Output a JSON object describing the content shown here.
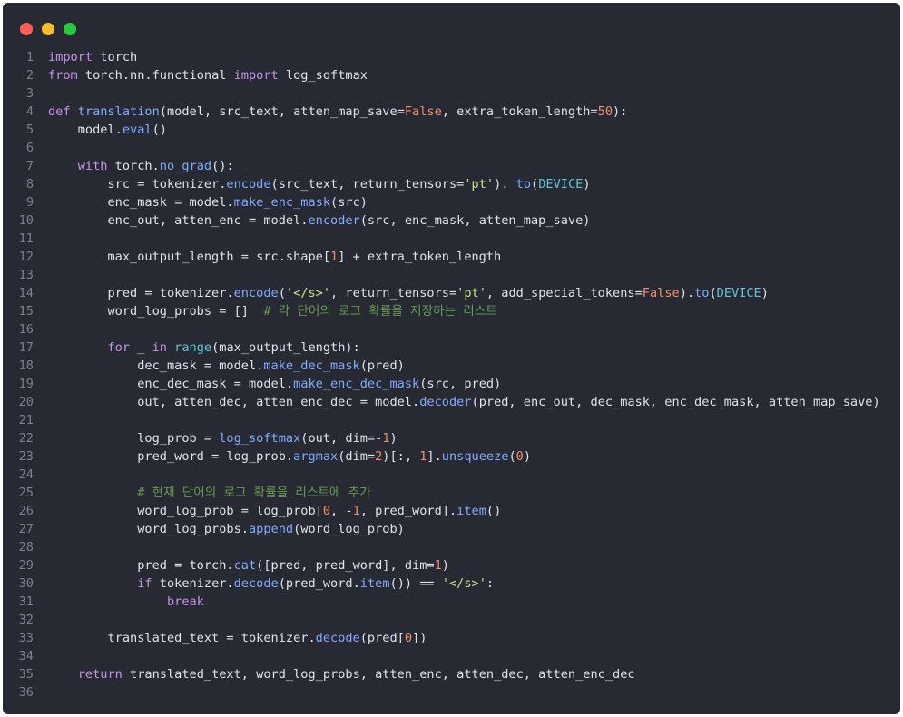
{
  "window": {
    "buttons": [
      {
        "name": "close",
        "color": "#ff5f57"
      },
      {
        "name": "minimize",
        "color": "#febc2e"
      },
      {
        "name": "maximize",
        "color": "#28c840"
      }
    ]
  },
  "theme": {
    "background": "#282a33",
    "keyword": "#c792ea",
    "function": "#82aaff",
    "number": "#f78c6c",
    "string": "#c3e88d",
    "comment": "#6a9955",
    "builtin": "#5fc4d4",
    "text": "#dfe3ea",
    "line_number": "#7a8093"
  },
  "lines": [
    [
      [
        "kw",
        "import"
      ],
      [
        "id",
        " torch"
      ]
    ],
    [
      [
        "kw",
        "from"
      ],
      [
        "id",
        " torch.nn.functional "
      ],
      [
        "kw",
        "import"
      ],
      [
        "id",
        " log_softmax"
      ]
    ],
    [],
    [
      [
        "kw",
        "def"
      ],
      [
        "id",
        " "
      ],
      [
        "fn",
        "translation"
      ],
      [
        "id",
        "(model, src_text, atten_map_save="
      ],
      [
        "num",
        "False"
      ],
      [
        "id",
        ", extra_token_length="
      ],
      [
        "num",
        "50"
      ],
      [
        "id",
        "):"
      ]
    ],
    [
      [
        "id",
        "    model."
      ],
      [
        "fn",
        "eval"
      ],
      [
        "id",
        "()"
      ]
    ],
    [],
    [
      [
        "id",
        "    "
      ],
      [
        "kw",
        "with"
      ],
      [
        "id",
        " torch."
      ],
      [
        "fn",
        "no_grad"
      ],
      [
        "id",
        "():"
      ]
    ],
    [
      [
        "id",
        "        src = tokenizer."
      ],
      [
        "fn",
        "encode"
      ],
      [
        "id",
        "(src_text, return_tensors="
      ],
      [
        "str",
        "'pt'"
      ],
      [
        "id",
        "). "
      ],
      [
        "fn",
        "to"
      ],
      [
        "id",
        "("
      ],
      [
        "bi",
        "DEVICE"
      ],
      [
        "id",
        ")"
      ]
    ],
    [
      [
        "id",
        "        enc_mask = model."
      ],
      [
        "fn",
        "make_enc_mask"
      ],
      [
        "id",
        "(src)"
      ]
    ],
    [
      [
        "id",
        "        enc_out, atten_enc = model."
      ],
      [
        "fn",
        "encoder"
      ],
      [
        "id",
        "(src, enc_mask, atten_map_save)"
      ]
    ],
    [],
    [
      [
        "id",
        "        max_output_length = src.shape["
      ],
      [
        "num",
        "1"
      ],
      [
        "id",
        "] + extra_token_length"
      ]
    ],
    [],
    [
      [
        "id",
        "        pred = tokenizer."
      ],
      [
        "fn",
        "encode"
      ],
      [
        "id",
        "("
      ],
      [
        "str",
        "'</s>'"
      ],
      [
        "id",
        ", return_tensors="
      ],
      [
        "str",
        "'pt'"
      ],
      [
        "id",
        ", add_special_tokens="
      ],
      [
        "num",
        "False"
      ],
      [
        "id",
        ")."
      ],
      [
        "fn",
        "to"
      ],
      [
        "id",
        "("
      ],
      [
        "bi",
        "DEVICE"
      ],
      [
        "id",
        ")"
      ]
    ],
    [
      [
        "id",
        "        word_log_probs = []  "
      ],
      [
        "com",
        "# 각 단어의 로그 확률을 저장하는 리스트"
      ]
    ],
    [],
    [
      [
        "id",
        "        "
      ],
      [
        "kw",
        "for"
      ],
      [
        "id",
        " _ "
      ],
      [
        "kw",
        "in"
      ],
      [
        "id",
        " "
      ],
      [
        "bi",
        "range"
      ],
      [
        "id",
        "(max_output_length):"
      ]
    ],
    [
      [
        "id",
        "            dec_mask = model."
      ],
      [
        "fn",
        "make_dec_mask"
      ],
      [
        "id",
        "(pred)"
      ]
    ],
    [
      [
        "id",
        "            enc_dec_mask = model."
      ],
      [
        "fn",
        "make_enc_dec_mask"
      ],
      [
        "id",
        "(src, pred)"
      ]
    ],
    [
      [
        "id",
        "            out, atten_dec, atten_enc_dec = model."
      ],
      [
        "fn",
        "decoder"
      ],
      [
        "id",
        "(pred, enc_out, dec_mask, enc_dec_mask, atten_map_save)"
      ]
    ],
    [],
    [
      [
        "id",
        "            log_prob = "
      ],
      [
        "fn",
        "log_softmax"
      ],
      [
        "id",
        "(out, dim=-"
      ],
      [
        "num",
        "1"
      ],
      [
        "id",
        ")"
      ]
    ],
    [
      [
        "id",
        "            pred_word = log_prob."
      ],
      [
        "fn",
        "argmax"
      ],
      [
        "id",
        "(dim="
      ],
      [
        "num",
        "2"
      ],
      [
        "id",
        ")[:,-"
      ],
      [
        "num",
        "1"
      ],
      [
        "id",
        "]."
      ],
      [
        "fn",
        "unsqueeze"
      ],
      [
        "id",
        "("
      ],
      [
        "num",
        "0"
      ],
      [
        "id",
        ")"
      ]
    ],
    [],
    [
      [
        "id",
        "            "
      ],
      [
        "com",
        "# 현재 단어의 로그 확률을 리스트에 추가"
      ]
    ],
    [
      [
        "id",
        "            word_log_prob = log_prob["
      ],
      [
        "num",
        "0"
      ],
      [
        "id",
        ", -"
      ],
      [
        "num",
        "1"
      ],
      [
        "id",
        ", pred_word]."
      ],
      [
        "fn",
        "item"
      ],
      [
        "id",
        "()"
      ]
    ],
    [
      [
        "id",
        "            word_log_probs."
      ],
      [
        "fn",
        "append"
      ],
      [
        "id",
        "(word_log_prob)"
      ]
    ],
    [],
    [
      [
        "id",
        "            pred = torch."
      ],
      [
        "fn",
        "cat"
      ],
      [
        "id",
        "([pred, pred_word], dim="
      ],
      [
        "num",
        "1"
      ],
      [
        "id",
        ")"
      ]
    ],
    [
      [
        "id",
        "            "
      ],
      [
        "kw",
        "if"
      ],
      [
        "id",
        " tokenizer."
      ],
      [
        "fn",
        "decode"
      ],
      [
        "id",
        "(pred_word."
      ],
      [
        "fn",
        "item"
      ],
      [
        "id",
        "()) == "
      ],
      [
        "str",
        "'</s>'"
      ],
      [
        "id",
        ":"
      ]
    ],
    [
      [
        "id",
        "                "
      ],
      [
        "kw",
        "break"
      ]
    ],
    [],
    [
      [
        "id",
        "        translated_text = tokenizer."
      ],
      [
        "fn",
        "decode"
      ],
      [
        "id",
        "(pred["
      ],
      [
        "num",
        "0"
      ],
      [
        "id",
        "])"
      ]
    ],
    [],
    [
      [
        "id",
        "    "
      ],
      [
        "kw",
        "return"
      ],
      [
        "id",
        " translated_text, word_log_probs, atten_enc, atten_dec, atten_enc_dec"
      ]
    ],
    []
  ]
}
